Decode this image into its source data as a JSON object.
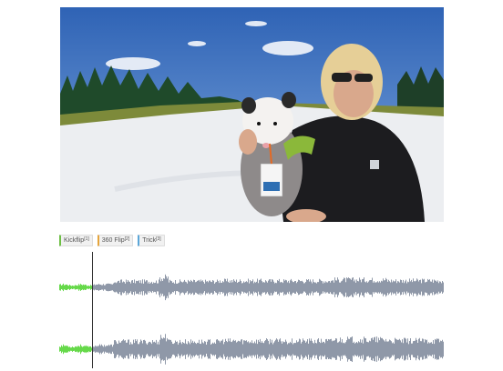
{
  "player": {
    "frame_icon": "video-frame",
    "scene": "snowy-slope-with-opossum"
  },
  "labels": [
    {
      "name": "Kickflip",
      "count": "[1]",
      "color": "#6dbf44"
    },
    {
      "name": "360 Flip",
      "count": "[2]",
      "color": "#e5a43b"
    },
    {
      "name": "Trick",
      "count": "[3]",
      "color": "#5aa6d8"
    }
  ],
  "waveform": {
    "channels": 2,
    "played_color": "#66d94a",
    "unplayed_color": "#8f98a8",
    "playhead_position": 0.085
  }
}
